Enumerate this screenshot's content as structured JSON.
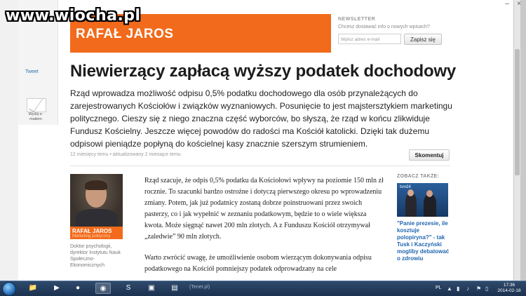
{
  "watermark": "www.wiocha.pl",
  "window_controls": {
    "minimize": "–",
    "close": "×"
  },
  "share": {
    "tweet_label": "Tweet",
    "email_label": "Wyślij e-mailem"
  },
  "author_banner": {
    "name": "RAFAŁ JAROS"
  },
  "newsletter": {
    "title": "NEWSLETTER",
    "description": "Chcesz dostawać info o nowych wpisach?",
    "email_placeholder": "Wpisz adres e-mail",
    "subscribe_label": "Zapisz się"
  },
  "article": {
    "headline": "Niewierzący zapłacą wyższy podatek dochodowy",
    "lead": "Rząd wprowadza możliwość odpisu 0,5% podatku dochodowego dla osób przynależących do zarejestrowanych Kościołów i związków wyznaniowych. Posunięcie to jest majstersztykiem marketingu politycznego. Cieszy się z niego znaczna część wyborców, bo słyszą, że rząd w końcu zlikwiduje Fundusz Kościelny. Jeszcze więcej powodów do radości ma Kościół katolicki. Dzięki tak dużemu odpisowi pieniądze popłyną do kościelnej kasy znacznie szerszym strumieniem.",
    "meta": "12 miesięcy temu • aktualizowany 2 miesiące temu",
    "comment_label": "Skomentuj",
    "paragraphs": [
      "Rząd szacuje, że odpis 0,5% podatku da Kościołowi wpływy na poziomie 150 mln zł rocznie. To szacunki bardzo ostrożne i dotyczą pierwszego okresu po wprowadzeniu zmiany. Potem, jak już podatnicy zostaną dobrze poinstruowani przez swoich pasterzy, co i jak wypełnić w zeznaniu podatkowym, będzie to o wiele większa kwota. Może sięgnąć nawet 200 mln złotych. A z Funduszu Kościół otrzymywał „zaledwie” 90 mln złotych.",
      "Warto zwrócić uwagę, że umożliwienie osobom wierzącym dokonywania odpisu podatkowego na Kościół pomniejszy podatek odprowadzany na cele"
    ]
  },
  "author_card": {
    "name": "RAFAŁ JAROS",
    "role": "Marketing polityczny",
    "bio": "Doktor psychologii, dyrektor Instytutu Nauk Społeczno-Ekonomicznych"
  },
  "see_also": {
    "title": "ZOBACZ TAKŻE:",
    "image_caption": "tvn24",
    "link": "\"Panie prezesie, ile kosztuje polopiryna?\" - tak Tusk i Kaczyński mogliby debatować o zdrowiu"
  },
  "taskbar": {
    "window_title": "(Tenet.pl)",
    "language": "PL",
    "time": "17:36",
    "date": "2014-02-18"
  }
}
